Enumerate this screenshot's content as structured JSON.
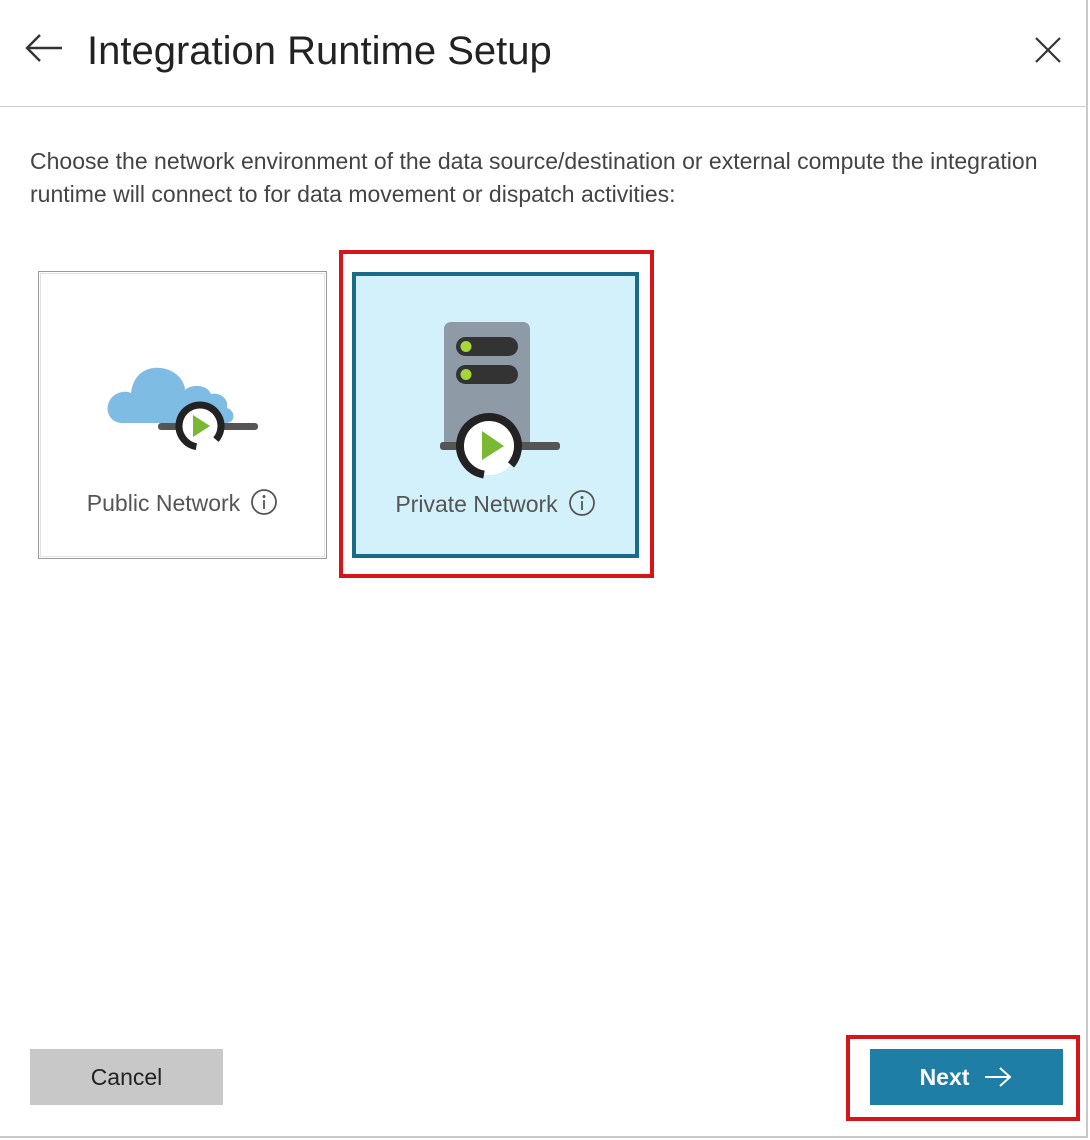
{
  "dialog": {
    "title": "Integration Runtime Setup",
    "back_icon": "arrow-left-icon",
    "close_icon": "close-icon"
  },
  "description": "Choose the network environment of the data source/destination or external compute the integration runtime will connect to for data movement or dispatch activities:",
  "options": [
    {
      "label": "Public Network",
      "icon": "cloud-runtime-icon",
      "selected": false
    },
    {
      "label": "Private Network",
      "icon": "server-runtime-icon",
      "selected": true
    }
  ],
  "footer": {
    "cancel_label": "Cancel",
    "next_label": "Next",
    "next_icon": "arrow-right-icon"
  },
  "colors": {
    "accent": "#1f7ea5",
    "selected_tile_bg": "#d2f1fb",
    "selected_tile_border": "#1a6a8a",
    "highlight": "#d7141a",
    "play_green": "#7ab733",
    "cloud_blue": "#7fbce4",
    "server_gray": "#8e9aa6"
  }
}
